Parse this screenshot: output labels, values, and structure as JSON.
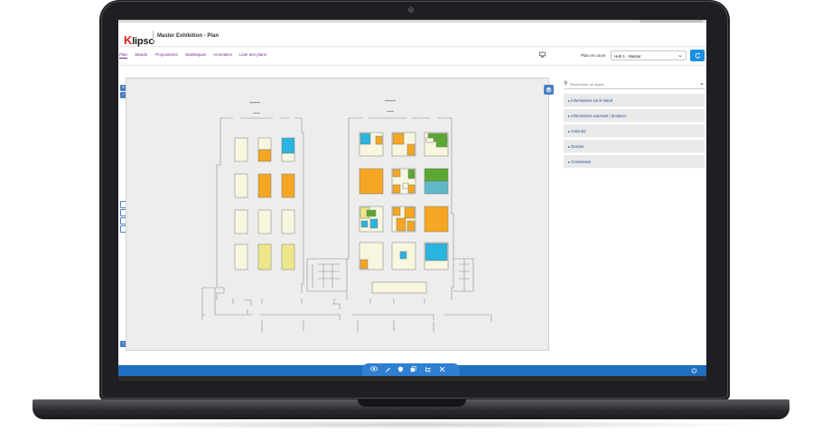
{
  "app": {
    "logo_k": "K",
    "logo_rest": "lipso",
    "title": "Master Exhibition - Plan"
  },
  "tabs": [
    {
      "label": "Plan"
    },
    {
      "label": "Stands"
    },
    {
      "label": "Propositions"
    },
    {
      "label": "Statistiques"
    },
    {
      "label": "Anomalies"
    },
    {
      "label": "Liste des plans"
    }
  ],
  "plan_selector": {
    "label": "Plan en cours",
    "value": "HAll 1 - Master"
  },
  "search": {
    "placeholder": "Rechercher un stand..."
  },
  "accordion": [
    {
      "label": "Informations sur le stand"
    },
    {
      "label": "Informations exposant / prospect"
    },
    {
      "label": "Action(s)"
    },
    {
      "label": "Dossier"
    },
    {
      "label": "Colorisation"
    }
  ],
  "colors": {
    "accent_blue": "#1a8fe0",
    "tab_purple": "#7a2a8a",
    "stand_orange": "#f5a623",
    "stand_yellow": "#eee78a",
    "stand_cream": "#f8f6df",
    "stand_green": "#5aa832",
    "stand_cyan": "#2ab4e0",
    "stand_teal": "#5fb8c8"
  },
  "icons": {
    "monitor": "monitor-icon",
    "refresh": "refresh-icon",
    "search": "search-icon",
    "layers": "layers-icon",
    "toolbar": [
      "eye-icon",
      "pencil-icon",
      "shape-icon",
      "copy-icon",
      "tree-icon",
      "tools-icon"
    ],
    "power": "power-icon"
  }
}
